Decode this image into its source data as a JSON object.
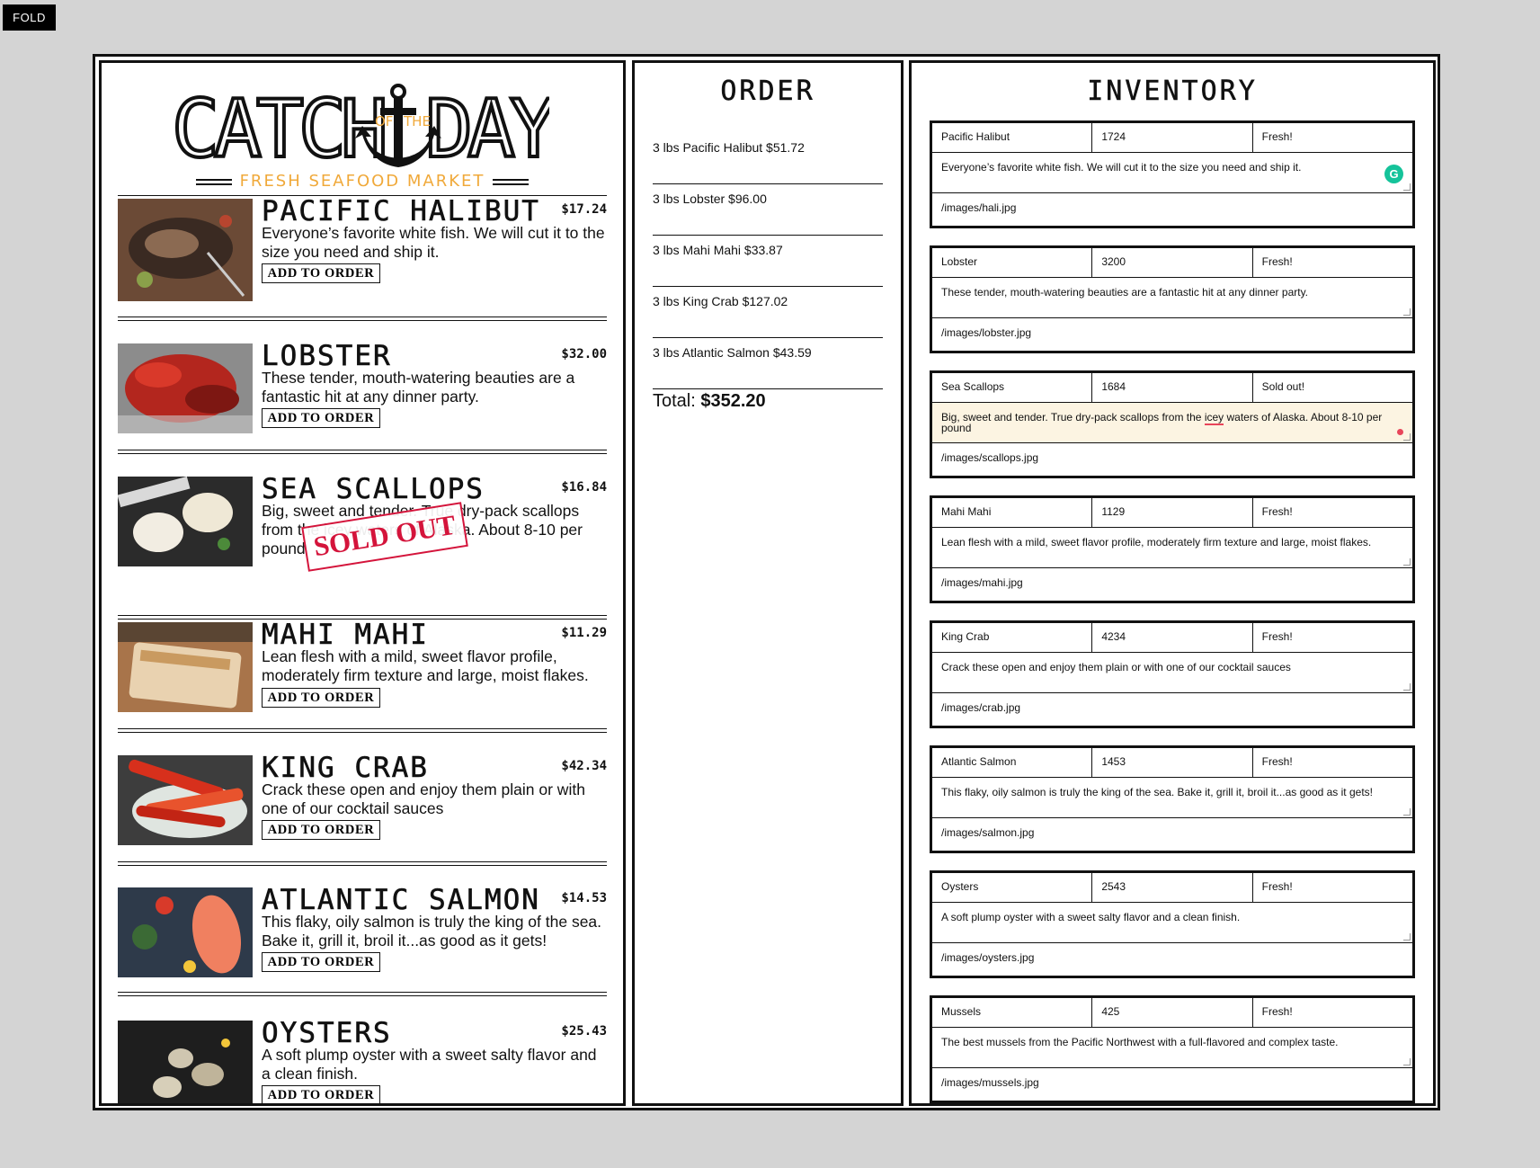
{
  "toolbar": {
    "fold_label": "FOLD"
  },
  "logo": {
    "word1": "CATCH",
    "of": "OF",
    "the": "THE",
    "word2": "DAY",
    "subtitle": "FRESH SEAFOOD MARKET"
  },
  "menu": {
    "add_label": "ADD TO ORDER",
    "sold_label": "SOLD OUT",
    "items": [
      {
        "name": "Pacific Halibut",
        "price": "$17.24",
        "desc": "Everyone’s favorite white fish. We will cut it to the size you need and ship it.",
        "sold": false
      },
      {
        "name": "Lobster",
        "price": "$32.00",
        "desc": "These tender, mouth-watering beauties are a fantastic hit at any dinner party.",
        "sold": false
      },
      {
        "name": "Sea Scallops",
        "price": "$16.84",
        "desc": "Big, sweet and tender. True dry-pack scallops from the icey waters of Alaska. About 8-10 per pound",
        "sold": true
      },
      {
        "name": "Mahi Mahi",
        "price": "$11.29",
        "desc": "Lean flesh with a mild, sweet flavor profile, moderately firm texture and large, moist flakes.",
        "sold": false
      },
      {
        "name": "King Crab",
        "price": "$42.34",
        "desc": "Crack these open and enjoy them plain or with one of our cocktail sauces",
        "sold": false
      },
      {
        "name": "Atlantic Salmon",
        "price": "$14.53",
        "desc": "This flaky, oily salmon is truly the king of the sea. Bake it, grill it, broil it...as good as it gets!",
        "sold": false
      },
      {
        "name": "Oysters",
        "price": "$25.43",
        "desc": "A soft plump oyster with a sweet salty flavor and a clean finish.",
        "sold": false
      }
    ]
  },
  "order": {
    "title": "ORDER",
    "lines": [
      "3 lbs Pacific Halibut $51.72",
      "3 lbs Lobster $96.00",
      "3 lbs Mahi Mahi $33.87",
      "3 lbs King Crab $127.02",
      "3 lbs Atlantic Salmon $43.59"
    ],
    "total_label": "Total:",
    "total_value": "$352.20"
  },
  "inventory": {
    "title": "INVENTORY",
    "items": [
      {
        "name": "Pacific Halibut",
        "price": "1724",
        "status": "Fresh!",
        "desc": "Everyone’s favorite white fish. We will cut it to the size you need and ship it.",
        "image": "/images/hali.jpg"
      },
      {
        "name": "Lobster",
        "price": "3200",
        "status": "Fresh!",
        "desc": "These tender, mouth-watering beauties are a fantastic hit at any dinner party.",
        "image": "/images/lobster.jpg"
      },
      {
        "name": "Sea Scallops",
        "price": "1684",
        "status": "Sold out!",
        "desc_a": "Big, sweet and tender. True dry-pack scallops from the ",
        "desc_b": "icey",
        "desc_c": " waters of Alaska. About 8-10 per pound",
        "image": "/images/scallops.jpg"
      },
      {
        "name": "Mahi Mahi",
        "price": "1129",
        "status": "Fresh!",
        "desc": "Lean flesh with a mild, sweet flavor profile, moderately firm texture and large, moist flakes.",
        "image": "/images/mahi.jpg"
      },
      {
        "name": "King Crab",
        "price": "4234",
        "status": "Fresh!",
        "desc": "Crack these open and enjoy them plain or with one of our cocktail sauces",
        "image": "/images/crab.jpg"
      },
      {
        "name": "Atlantic Salmon",
        "price": "1453",
        "status": "Fresh!",
        "desc": "This flaky, oily salmon is truly the king of the sea. Bake it, grill it, broil it...as good as it gets!",
        "image": "/images/salmon.jpg"
      },
      {
        "name": "Oysters",
        "price": "2543",
        "status": "Fresh!",
        "desc": "A soft plump oyster with a sweet salty flavor and a clean finish.",
        "image": "/images/oysters.jpg"
      },
      {
        "name": "Mussels",
        "price": "425",
        "status": "Fresh!",
        "desc": "The best mussels from the Pacific Northwest with a full-flavored and complex taste.",
        "image": "/images/mussels.jpg"
      }
    ]
  },
  "colors": {
    "accent": "#f0a93a",
    "sold": "#d4143b",
    "grammarly": "#15c39a"
  }
}
